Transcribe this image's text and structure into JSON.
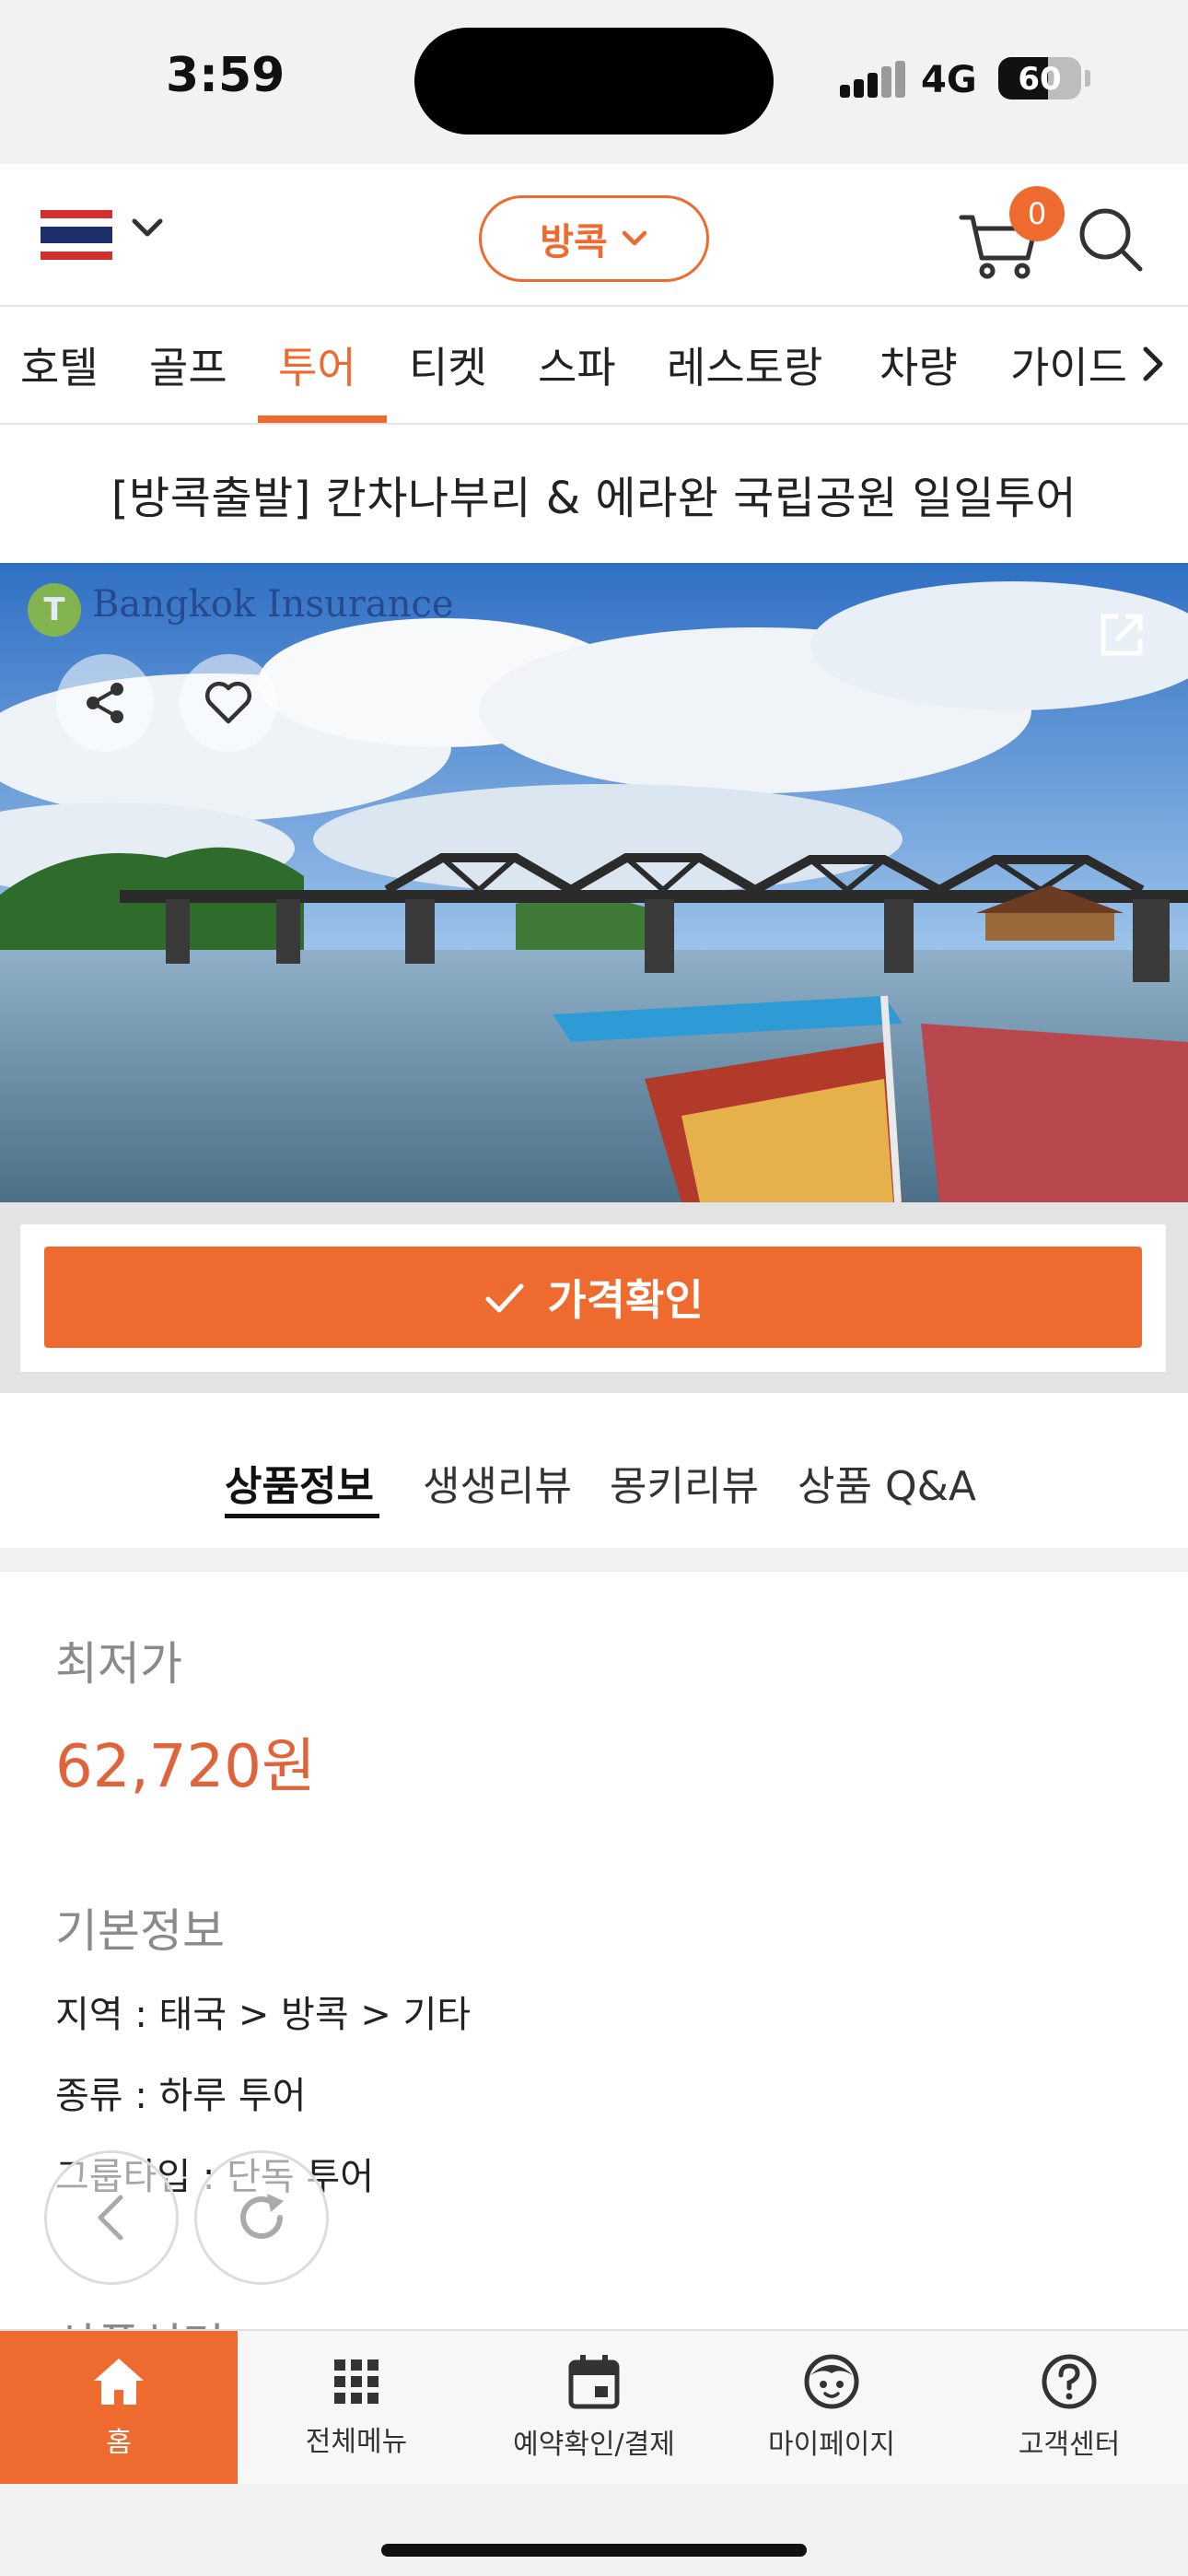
{
  "status_bar": {
    "time": "3:59",
    "network": "4G",
    "battery": "60"
  },
  "header": {
    "city_label": "방콕",
    "cart_count": "0"
  },
  "categories": [
    {
      "label": "호텔"
    },
    {
      "label": "골프"
    },
    {
      "label": "투어"
    },
    {
      "label": "티켓"
    },
    {
      "label": "스파"
    },
    {
      "label": "레스토랑"
    },
    {
      "label": "차량"
    },
    {
      "label": "가이드"
    }
  ],
  "product": {
    "title": "[방콕출발] 칸차나부리 & 에라완 국립공원 일일투어",
    "image_watermark": "Bangkok Insurance",
    "badge_letter": "T"
  },
  "price_check_label": "가격확인",
  "tabs": [
    {
      "label": "상품정보"
    },
    {
      "label": "생생리뷰"
    },
    {
      "label": "몽키리뷰"
    },
    {
      "label": "상품 Q&A"
    }
  ],
  "details": {
    "lowest_price_label": "최저가",
    "lowest_price": "62,720원",
    "basic_info_label": "기본정보",
    "region": "지역 : 태국 > 방콕 > 기타",
    "kind": "종류 : 하루 투어",
    "group_type": "그룹타입 : 단독 투어",
    "description_label": "상품설명"
  },
  "bottom_nav": [
    {
      "label": "홈",
      "icon": "home-icon"
    },
    {
      "label": "전체메뉴",
      "icon": "grid-icon"
    },
    {
      "label": "예약확인/결제",
      "icon": "calendar-icon"
    },
    {
      "label": "마이페이지",
      "icon": "user-face-icon"
    },
    {
      "label": "고객센터",
      "icon": "help-icon"
    }
  ],
  "colors": {
    "accent": "#ee6a2e",
    "price": "#e1633a"
  }
}
